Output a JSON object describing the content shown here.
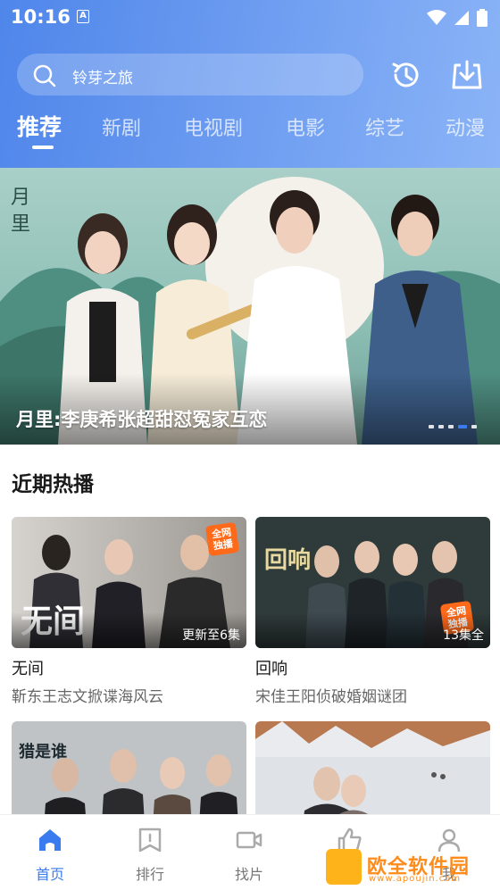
{
  "status_bar": {
    "time": "10:16",
    "notification_glyph": "A"
  },
  "search": {
    "placeholder": "铃芽之旅"
  },
  "header_buttons": {
    "history_icon": "history-icon",
    "download_icon": "download-icon"
  },
  "tabs": [
    {
      "label": "推荐",
      "active": true
    },
    {
      "label": "新剧"
    },
    {
      "label": "电视剧"
    },
    {
      "label": "电影"
    },
    {
      "label": "综艺"
    },
    {
      "label": "动漫"
    }
  ],
  "banner": {
    "caption": "月里:李庚希张超甜怼冤家互恋",
    "slide_count": 5,
    "active_slide": 3
  },
  "section": {
    "title": "近期热播"
  },
  "cards": [
    {
      "title": "无间",
      "desc": "靳东王志文掀谍海风云",
      "status": "更新至6集",
      "badge": "全网\n独播",
      "thumb_text": "无间"
    },
    {
      "title": "回响",
      "desc": "宋佳王阳侦破婚姻谜团",
      "status": "13集全",
      "badge": "全网\n独播",
      "thumb_text": "回响"
    },
    {
      "title": "",
      "desc": "",
      "status": "",
      "thumb_text": "猎是谁"
    },
    {
      "title": "",
      "desc": "",
      "status": ""
    }
  ],
  "bottom_nav": [
    {
      "label": "首页",
      "icon": "home-icon",
      "active": true
    },
    {
      "label": "排行",
      "icon": "ranking-icon"
    },
    {
      "label": "找片",
      "icon": "video-camera-icon"
    },
    {
      "label": "推",
      "icon": "thumbs-up-icon"
    },
    {
      "label": "我",
      "icon": "user-icon"
    }
  ],
  "watermark": {
    "text": "欧全软件园",
    "url": "www.apoujin.com"
  },
  "colors": {
    "accent": "#3a7bf0",
    "header_start": "#4f86ea",
    "header_end": "#8bb4f7"
  }
}
